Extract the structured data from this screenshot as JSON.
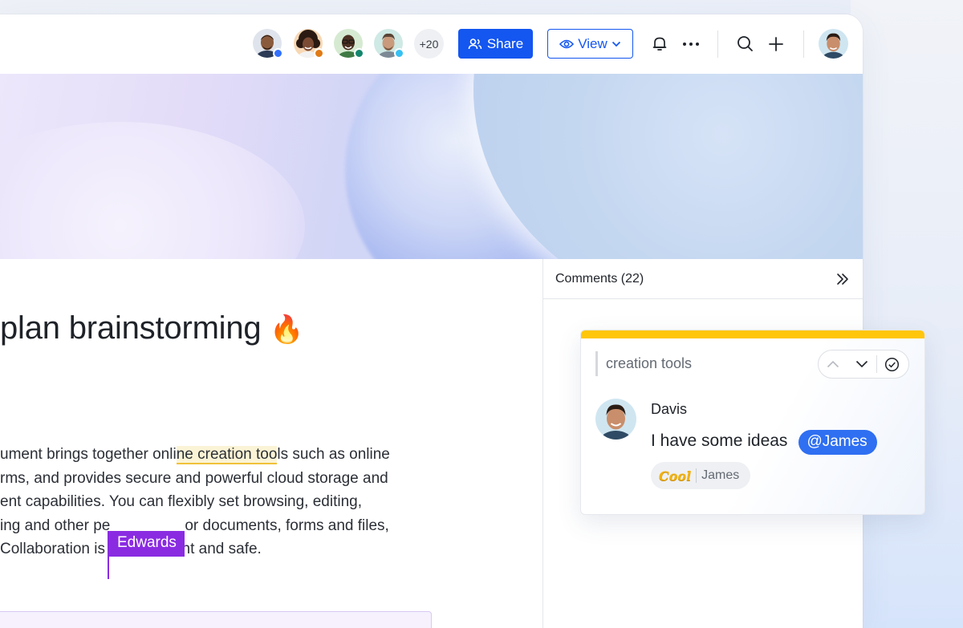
{
  "toolbar": {
    "collaborators": [
      {
        "name": "collaborator-1",
        "status_color": "#3370ff",
        "skin": "#8a5a3c",
        "bg": "#dfe4ec"
      },
      {
        "name": "collaborator-2",
        "status_color": "#e07a14",
        "skin": "#6d4330",
        "bg": "#f7d8b5"
      },
      {
        "name": "collaborator-3",
        "status_color": "#14866d",
        "skin": "#4b3022",
        "bg": "#d6ead2"
      },
      {
        "name": "collaborator-4",
        "status_color": "#37c1f2",
        "skin": "#c99a7b",
        "bg": "#cfe9e4"
      }
    ],
    "more_count": "+20",
    "share_label": "Share",
    "view_label": "View",
    "accent": "#1456f0"
  },
  "document": {
    "title": "plan brainstorming",
    "title_emoji": "🔥",
    "paragraph": {
      "line1_before": "ument brings together onli",
      "line1_hl_pre": "n",
      "line1_hl": "e creation too",
      "line1_after": "ls such as online",
      "line2": "rms, and provides secure and powerful cloud storage and",
      "line3": "ent capabilities. You can flexibly set browsing, editing,",
      "line4_before": "ing and other pe",
      "line4_after": "or documents, forms and files,",
      "line5_before": "Collaboration is",
      "line5_after": "both efficient and safe."
    },
    "cursor_user": "Edwards",
    "cursor_color": "#8a2be2"
  },
  "comments": {
    "title": "Comments (22)",
    "card": {
      "quote": "creation tools",
      "author": "Davis",
      "text": "I have some ideas",
      "mention": "@James",
      "reaction_sticker": "Cool",
      "reaction_user": "James",
      "accent_bar": "#ffc60a"
    }
  }
}
